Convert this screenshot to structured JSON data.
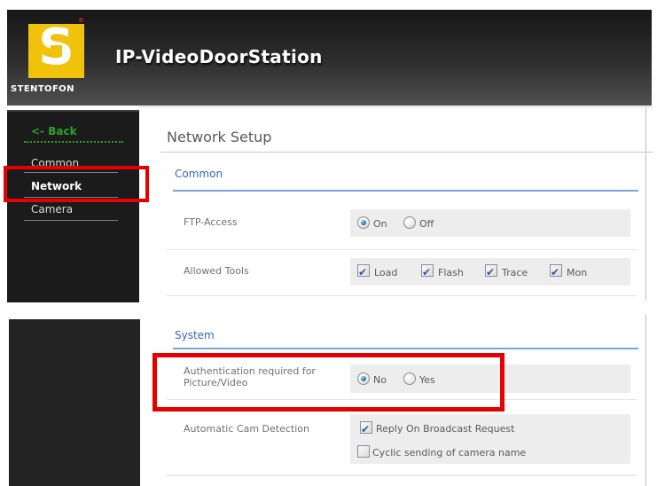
{
  "header": {
    "title": "IP-VideoDoorStation",
    "brand": "STENTOFON",
    "logo_letter": "S",
    "registered": "®"
  },
  "sidebar": {
    "back": "<- Back",
    "items": [
      {
        "label": "Common",
        "active": false
      },
      {
        "label": "Network",
        "active": true
      },
      {
        "label": "Camera",
        "active": false
      }
    ]
  },
  "page": {
    "title": "Network Setup"
  },
  "sections": [
    {
      "heading": "Common",
      "rows": [
        {
          "label": "FTP-Access",
          "type": "radio-group",
          "options": [
            {
              "label": "On",
              "selected": true
            },
            {
              "label": "Off",
              "selected": false
            }
          ]
        },
        {
          "label": "Allowed Tools",
          "type": "checkbox-group",
          "options": [
            {
              "label": "Load",
              "checked": true
            },
            {
              "label": "Flash",
              "checked": true
            },
            {
              "label": "Trace",
              "checked": true
            },
            {
              "label": "Mon",
              "checked": true
            }
          ]
        }
      ]
    },
    {
      "heading": "System",
      "rows": [
        {
          "label": "Authentication required for Picture/Video",
          "type": "radio-group",
          "options": [
            {
              "label": "No",
              "selected": true
            },
            {
              "label": "Yes",
              "selected": false
            }
          ]
        },
        {
          "label": "Automatic Cam Detection",
          "type": "checkbox-stack",
          "options": [
            {
              "label": "Reply On Broadcast Request",
              "checked": true
            },
            {
              "label": "Cyclic sending of camera name",
              "checked": false
            }
          ]
        }
      ]
    }
  ],
  "annotations": {
    "highlight_color": "#e60000",
    "highlighted": [
      "sidebar Network item",
      "Authentication required for Picture/Video row"
    ]
  },
  "colors": {
    "accent_blue": "#3565bf",
    "section_underline": "#7ba6da",
    "logo_yellow": "#f0c20c",
    "back_green": "#2fa02f",
    "option_box_gray": "#ededed"
  }
}
